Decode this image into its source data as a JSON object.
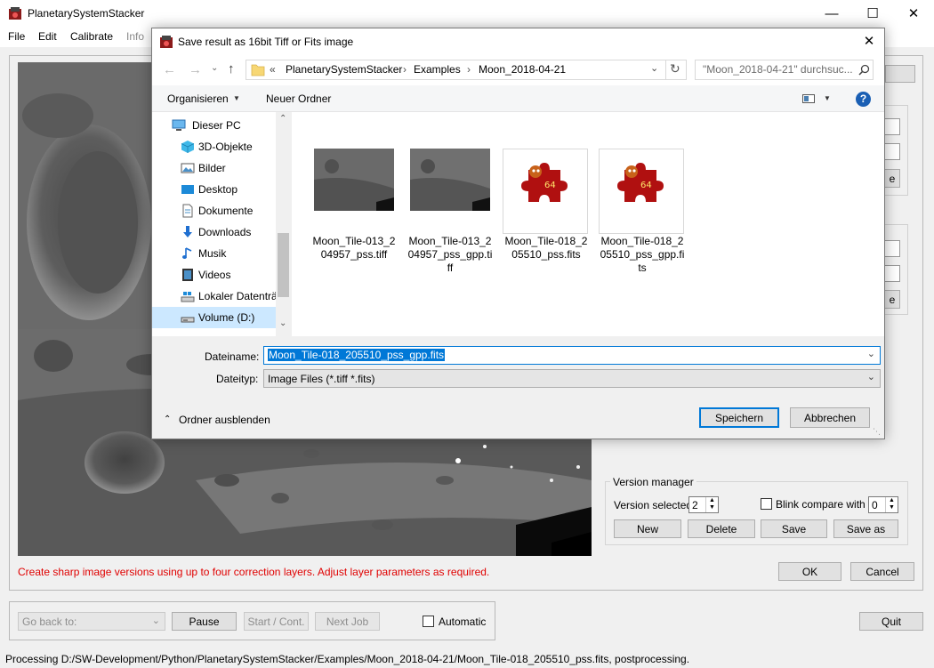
{
  "window": {
    "title": "PlanetarySystemStacker"
  },
  "menu": [
    "File",
    "Edit",
    "Calibrate",
    "Info"
  ],
  "hint": "Create sharp image versions using up to four correction layers. Adjust layer parameters as required.",
  "version_manager": {
    "title": "Version manager",
    "version_selected_label": "Version selected",
    "version_selected_value": "2",
    "blink_label": "Blink compare with",
    "blink_value": "0",
    "buttons": {
      "new": "New",
      "delete": "Delete",
      "save": "Save",
      "save_as": "Save as"
    }
  },
  "dialog_buttons": {
    "ok": "OK",
    "cancel": "Cancel"
  },
  "job_bar": {
    "go_back_placeholder": "Go back to:",
    "pause": "Pause",
    "start": "Start / Cont.",
    "next_job": "Next Job",
    "automatic_label": "Automatic"
  },
  "quit": "Quit",
  "status": "Processing D:/SW-Development/Python/PlanetarySystemStacker/Examples/Moon_2018-04-21/Moon_Tile-018_205510_pss.fits, postprocessing.",
  "partial_labels": {
    "right_edge_button": "e"
  },
  "save_dialog": {
    "title": "Save result as 16bit Tiff or Fits image",
    "breadcrumb": [
      "PlanetarySystemStacker",
      "Examples",
      "Moon_2018-04-21"
    ],
    "breadcrumb_prefix": "«",
    "search_placeholder": "\"Moon_2018-04-21\" durchsuc...",
    "organize": "Organisieren",
    "new_folder": "Neuer Ordner",
    "nav_items": [
      {
        "label": "Dieser PC",
        "icon": "pc-icon"
      },
      {
        "label": "3D-Objekte",
        "icon": "cube-icon"
      },
      {
        "label": "Bilder",
        "icon": "pictures-icon"
      },
      {
        "label": "Desktop",
        "icon": "desktop-icon"
      },
      {
        "label": "Dokumente",
        "icon": "documents-icon"
      },
      {
        "label": "Downloads",
        "icon": "download-icon"
      },
      {
        "label": "Musik",
        "icon": "music-icon"
      },
      {
        "label": "Videos",
        "icon": "video-icon"
      },
      {
        "label": "Lokaler Datenträ",
        "icon": "drive-icon"
      },
      {
        "label": "Volume (D:)",
        "icon": "drive-icon"
      }
    ],
    "files": [
      {
        "name": "Moon_Tile-013_204957_pss.tiff",
        "type": "moon-thumbnail"
      },
      {
        "name": "Moon_Tile-013_204957_pss_gpp.tiff",
        "type": "moon-thumbnail"
      },
      {
        "name": "Moon_Tile-018_205510_pss.fits",
        "type": "fits-icon",
        "badge": "64"
      },
      {
        "name": "Moon_Tile-018_205510_pss_gpp.fits",
        "type": "fits-icon",
        "badge": "64"
      }
    ],
    "filename_label": "Dateiname:",
    "filename_value": "Moon_Tile-018_205510_pss_gpp.fits",
    "filetype_label": "Dateityp:",
    "filetype_value": "Image Files (*.tiff *.fits)",
    "hide_folders": "Ordner ausblenden",
    "save_button": "Speichern",
    "cancel_button": "Abbrechen",
    "accent_color": "#0078d7"
  }
}
